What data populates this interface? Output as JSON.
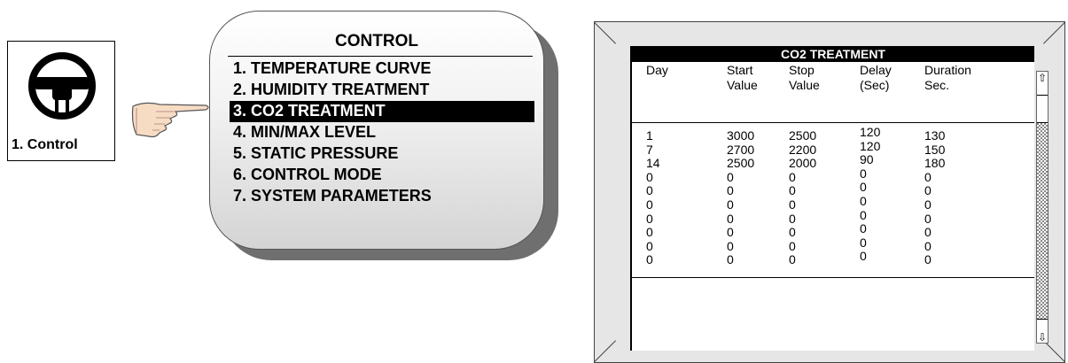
{
  "icon_box": {
    "label": "1. Control"
  },
  "menu": {
    "title": "CONTROL",
    "items": [
      {
        "label": "1. TEMPERATURE CURVE",
        "selected": false
      },
      {
        "label": "2. HUMIDITY TREATMENT",
        "selected": false
      },
      {
        "label": "3. CO2 TREATMENT",
        "selected": true
      },
      {
        "label": "4. MIN/MAX LEVEL",
        "selected": false
      },
      {
        "label": "5. STATIC PRESSURE",
        "selected": false
      },
      {
        "label": "6. CONTROL MODE",
        "selected": false
      },
      {
        "label": "7. SYSTEM PARAMETERS",
        "selected": false
      }
    ]
  },
  "screen": {
    "title": "CO2 TREATMENT",
    "columns": {
      "day": [
        "Day",
        ""
      ],
      "start": [
        "Start",
        "Value"
      ],
      "stop": [
        "Stop",
        "Value"
      ],
      "delay": [
        "Delay",
        "(Sec)"
      ],
      "duration": [
        "Duration",
        "Sec."
      ]
    },
    "rows": [
      {
        "day": "1",
        "start": "3000",
        "stop": "2500",
        "delay": "120",
        "duration": "130"
      },
      {
        "day": "7",
        "start": "2700",
        "stop": "2200",
        "delay": "120",
        "duration": "150"
      },
      {
        "day": "14",
        "start": "2500",
        "stop": "2000",
        "delay": "90",
        "duration": "180"
      },
      {
        "day": "0",
        "start": "0",
        "stop": "0",
        "delay": "0",
        "duration": "0"
      },
      {
        "day": "0",
        "start": "0",
        "stop": "0",
        "delay": "0",
        "duration": "0"
      },
      {
        "day": "0",
        "start": "0",
        "stop": "0",
        "delay": "0",
        "duration": "0"
      },
      {
        "day": "0",
        "start": "0",
        "stop": "0",
        "delay": "0",
        "duration": "0"
      },
      {
        "day": "0",
        "start": "0",
        "stop": "0",
        "delay": "0",
        "duration": "0"
      },
      {
        "day": "0",
        "start": "0",
        "stop": "0",
        "delay": "0",
        "duration": "0"
      },
      {
        "day": "0",
        "start": "0",
        "stop": "0",
        "delay": "0",
        "duration": "0"
      }
    ],
    "scroll": {
      "up_icon": "arrow-up-icon",
      "down_icon": "arrow-down-icon"
    }
  }
}
